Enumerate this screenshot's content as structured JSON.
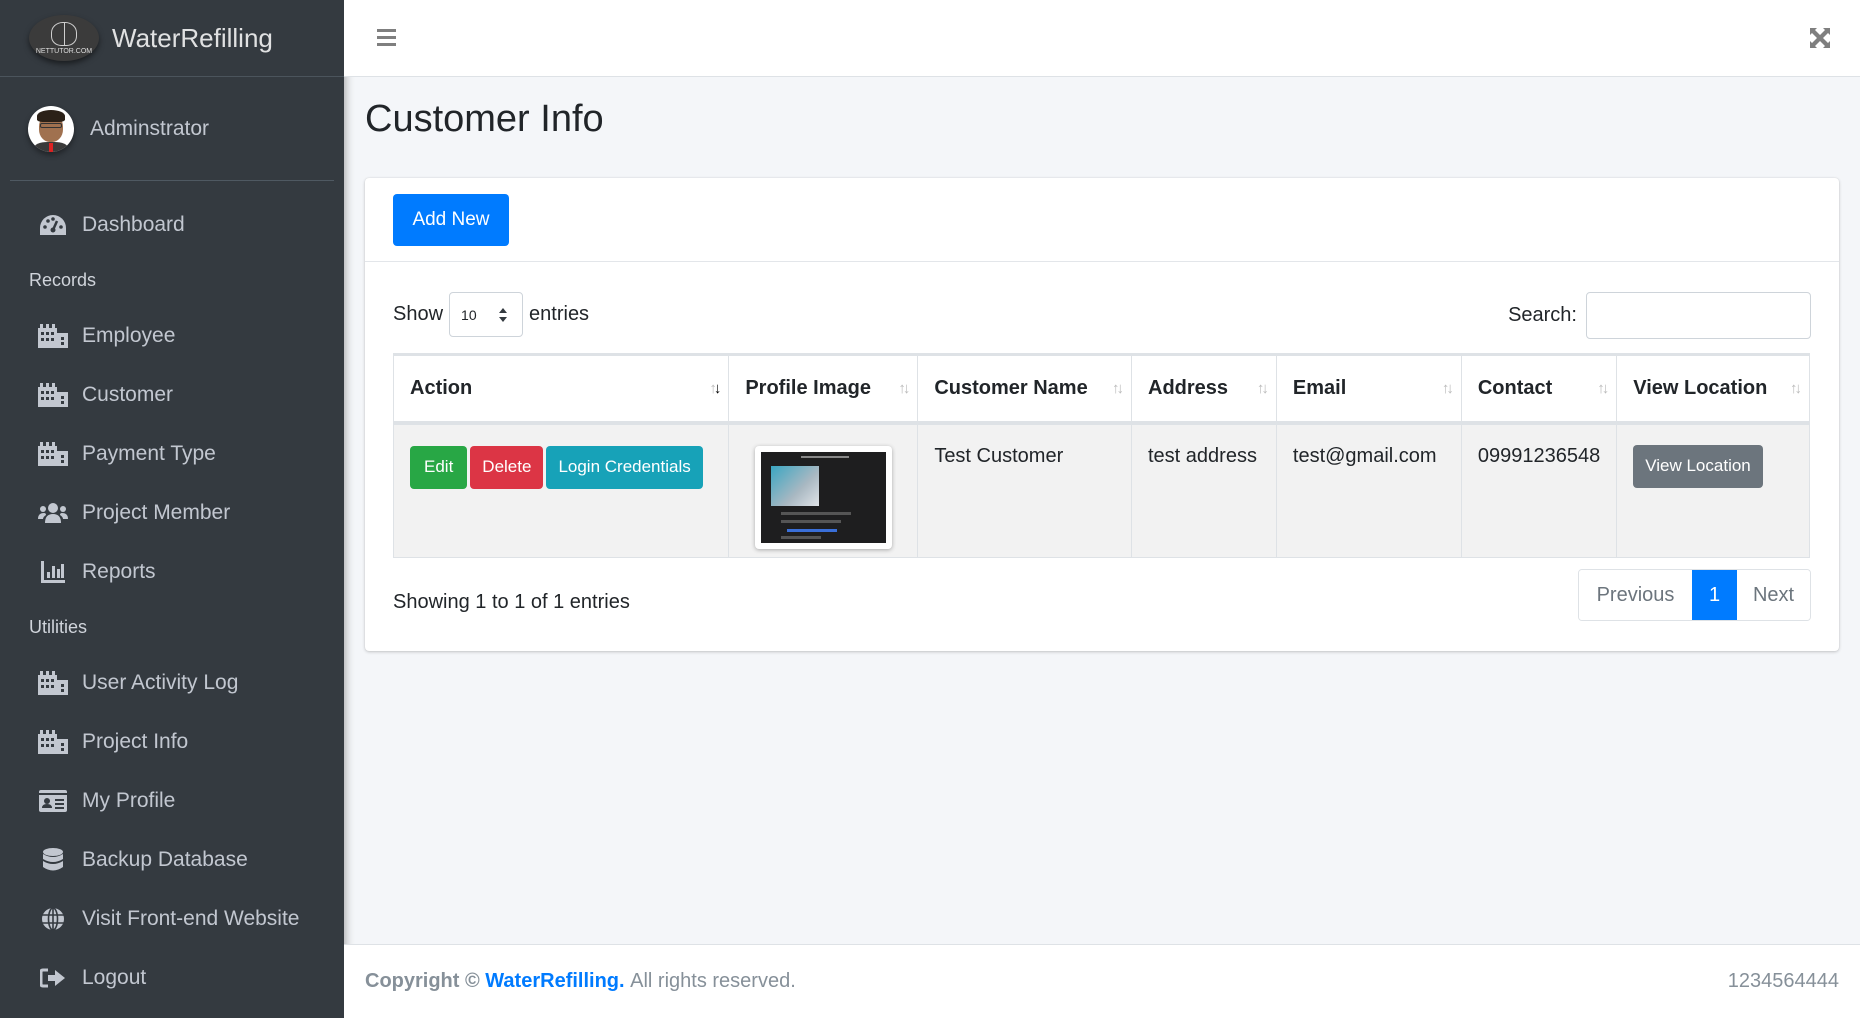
{
  "brand": {
    "name": "WaterRefilling",
    "logo_text": "NETTUTOR.COM"
  },
  "user": {
    "name": "Adminstrator"
  },
  "sidebar": {
    "items": [
      {
        "type": "item",
        "label": "Dashboard",
        "icon": "tachometer-icon"
      },
      {
        "type": "header",
        "label": "Records"
      },
      {
        "type": "item",
        "label": "Employee",
        "icon": "building-icon"
      },
      {
        "type": "item",
        "label": "Customer",
        "icon": "building-icon"
      },
      {
        "type": "item",
        "label": "Payment Type",
        "icon": "building-icon"
      },
      {
        "type": "item",
        "label": "Project Member",
        "icon": "users-icon"
      },
      {
        "type": "item",
        "label": "Reports",
        "icon": "chart-bar-icon"
      },
      {
        "type": "header",
        "label": "Utilities"
      },
      {
        "type": "item",
        "label": "User Activity Log",
        "icon": "building-icon"
      },
      {
        "type": "item",
        "label": "Project Info",
        "icon": "building-icon"
      },
      {
        "type": "item",
        "label": "My Profile",
        "icon": "id-card-icon"
      },
      {
        "type": "item",
        "label": "Backup Database",
        "icon": "database-icon"
      },
      {
        "type": "item",
        "label": "Visit Front-end Website",
        "icon": "globe-icon"
      },
      {
        "type": "item",
        "label": "Logout",
        "icon": "sign-out-icon"
      }
    ]
  },
  "page": {
    "title": "Customer Info"
  },
  "toolbar": {
    "add_new_label": "Add New"
  },
  "datatable": {
    "show_label": "Show",
    "entries_label": "entries",
    "page_length": "10",
    "search_label": "Search:",
    "search_value": "",
    "columns": [
      "Action",
      "Profile Image",
      "Customer Name",
      "Address",
      "Email",
      "Contact",
      "View Location"
    ],
    "rows": [
      {
        "actions": [
          "Edit",
          "Delete",
          "Login Credentials"
        ],
        "customer_name": "Test Customer",
        "address": "test address",
        "email": "test@gmail.com",
        "contact": "09991236548",
        "view_location_label": "View Location"
      }
    ],
    "info": "Showing 1 to 1 of 1 entries",
    "pagination": {
      "previous": "Previous",
      "current": "1",
      "next": "Next"
    }
  },
  "footer": {
    "copyright_prefix": "Copyright ©",
    "brand_link": "WaterRefilling.",
    "rights": "All rights reserved.",
    "right_text": "1234564444"
  },
  "colors": {
    "primary": "#007bff",
    "success": "#28a745",
    "danger": "#dc3545",
    "info": "#17a2b8",
    "secondary": "#6c757d",
    "sidebar_bg": "#343a40"
  }
}
